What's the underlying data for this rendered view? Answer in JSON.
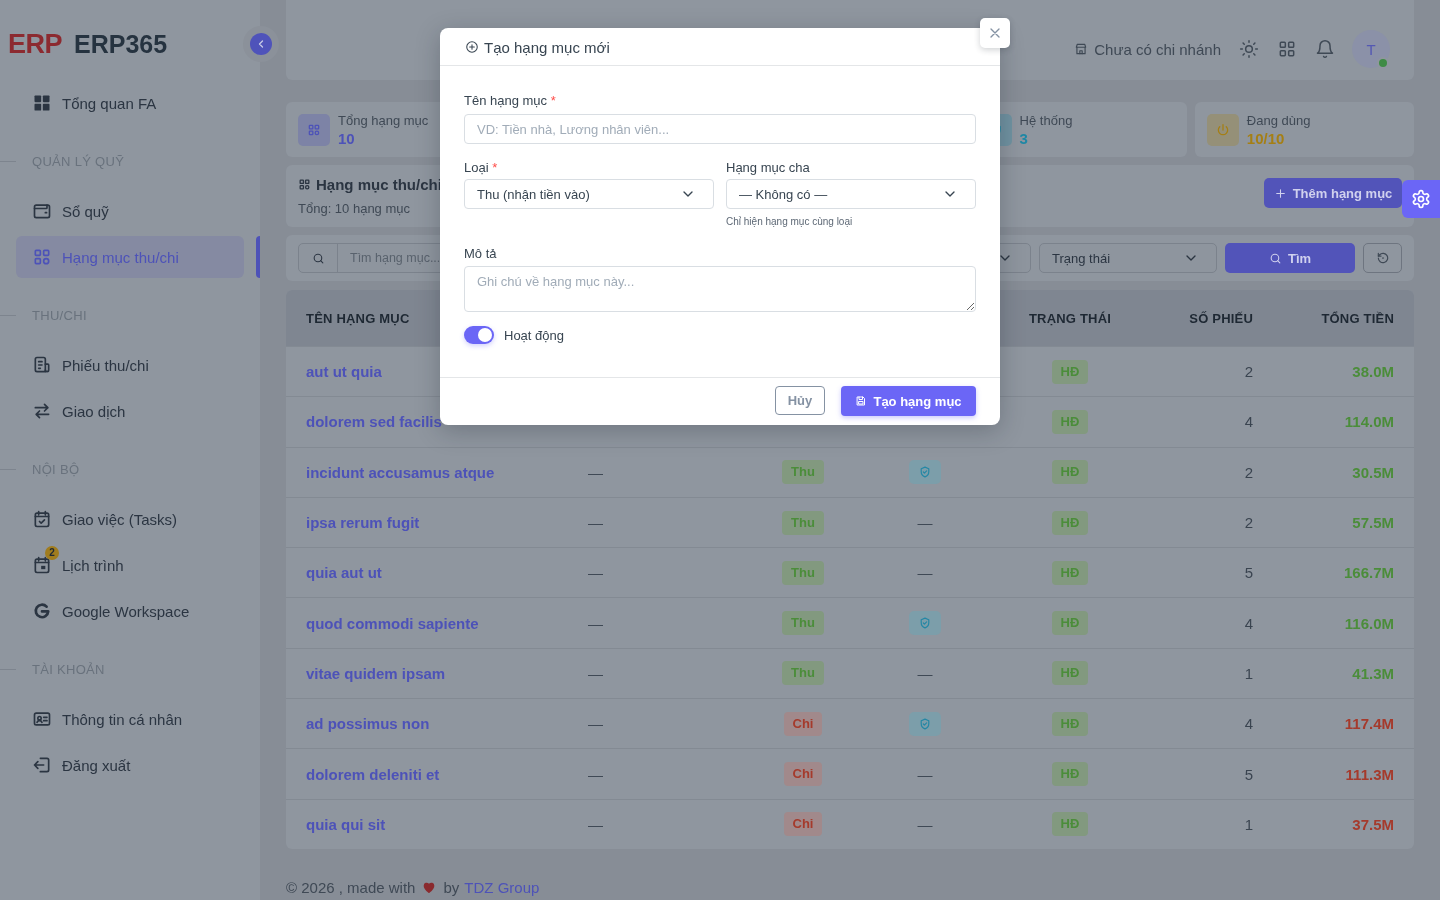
{
  "sidebar": {
    "logo_mark": "ERP",
    "brand": "ERP365",
    "groups": [
      {
        "items": [
          {
            "label": "Tổng quan FA",
            "selected": false
          }
        ]
      },
      {
        "heading": "QUẢN LÝ QUỸ",
        "items": [
          {
            "label": "Sổ quỹ",
            "selected": false
          },
          {
            "label": "Hạng mục thu/chi",
            "selected": true
          }
        ]
      },
      {
        "heading": "THU/CHI",
        "items": [
          {
            "label": "Phiếu thu/chi",
            "selected": false
          },
          {
            "label": "Giao dịch",
            "selected": false
          }
        ]
      },
      {
        "heading": "NỘI BỘ",
        "items": [
          {
            "label": "Giao việc (Tasks)",
            "selected": false
          },
          {
            "label": "Lịch trình",
            "selected": false,
            "badge": "2"
          },
          {
            "label": "Google Workspace",
            "selected": false
          }
        ]
      },
      {
        "heading": "TÀI KHOẢN",
        "items": [
          {
            "label": "Thông tin cá nhân",
            "selected": false
          },
          {
            "label": "Đăng xuất",
            "selected": false
          }
        ]
      }
    ]
  },
  "navbar": {
    "branch": "Chưa có chi nhánh",
    "avatar_initial": "T",
    "online": true
  },
  "stats": [
    {
      "label": "Tổng hạng mục",
      "value": "10",
      "color": "#4d52b8"
    },
    {
      "label": "Hệ thống",
      "value": "3",
      "color": "#1f88a6"
    },
    {
      "label": "Đang dùng",
      "value": "10/10",
      "color": "#a57f14"
    }
  ],
  "page_header": {
    "title": "Hạng mục thu/chi",
    "subtitle": "Tổng: 10 hạng mục",
    "add_button": "Thêm hạng mục"
  },
  "filters": {
    "search": {
      "placeholder": "Tìm hạng mục..."
    },
    "status_select": {
      "placeholder": "Trạng thái"
    },
    "search_button": "Tìm"
  },
  "table": {
    "columns": [
      "TÊN HẠNG MỤC",
      "TRẠNG THÁI",
      "SỐ PHIẾU",
      "TỔNG TIỀN"
    ],
    "rows": [
      {
        "name": "aut ut quia",
        "kind": "thu",
        "status": "HĐ",
        "active": true,
        "count": "2",
        "total": "38.0M"
      },
      {
        "name": "dolorem sed facilis",
        "kind": "thu",
        "status": "HĐ",
        "active": true,
        "count": "4",
        "total": "114.0M"
      },
      {
        "name": "incidunt accusamus atque",
        "kind": "thu",
        "parent": "—",
        "type": "Thu",
        "system": true,
        "status": "HĐ",
        "active": true,
        "count": "2",
        "total": "30.5M"
      },
      {
        "name": "ipsa rerum fugit",
        "kind": "thu",
        "parent": "—",
        "type": "Thu",
        "system": false,
        "system_text": "—",
        "status": "HĐ",
        "active": true,
        "count": "2",
        "total": "57.5M"
      },
      {
        "name": "quia aut ut",
        "kind": "thu",
        "parent": "—",
        "type": "Thu",
        "system": false,
        "system_text": "—",
        "status": "HĐ",
        "active": true,
        "count": "5",
        "total": "166.7M"
      },
      {
        "name": "quod commodi sapiente",
        "kind": "thu",
        "parent": "—",
        "type": "Thu",
        "system": true,
        "status": "HĐ",
        "active": true,
        "count": "4",
        "total": "116.0M"
      },
      {
        "name": "vitae quidem ipsam",
        "kind": "thu",
        "parent": "—",
        "type": "Thu",
        "system": false,
        "system_text": "—",
        "status": "HĐ",
        "active": true,
        "count": "1",
        "total": "41.3M"
      },
      {
        "name": "ad possimus non",
        "kind": "chi",
        "parent": "—",
        "type": "Chi",
        "system": true,
        "status": "HĐ",
        "active": true,
        "count": "4",
        "total": "117.4M"
      },
      {
        "name": "dolorem deleniti et",
        "kind": "chi",
        "parent": "—",
        "type": "Chi",
        "system": false,
        "system_text": "—",
        "status": "HĐ",
        "active": true,
        "count": "5",
        "total": "111.3M"
      },
      {
        "name": "quia qui sit",
        "kind": "chi",
        "parent": "—",
        "type": "Chi",
        "system": false,
        "system_text": "—",
        "status": "HĐ",
        "active": true,
        "count": "1",
        "total": "37.5M"
      }
    ]
  },
  "modal": {
    "title": "Tạo hạng mục mới",
    "name_field": {
      "label": "Tên hạng mục",
      "required_mark": "*",
      "placeholder": "VD: Tiền nhà, Lương nhân viên..."
    },
    "type_field": {
      "label": "Loại",
      "required_mark": "*",
      "value": "Thu (nhận tiền vào)"
    },
    "parent_field": {
      "label": "Hạng mục cha",
      "value": "— Không có —",
      "hint": "Chỉ hiện hạng mục cùng loại"
    },
    "description_field": {
      "label": "Mô tả",
      "placeholder": "Ghi chú về hạng mục này..."
    },
    "active_toggle": {
      "label": "Hoạt động",
      "on": true
    },
    "cancel_button": "Hủy",
    "submit_button": "Tạo hạng mục"
  },
  "footer": {
    "text": "© 2026 , made with",
    "text_after": "by",
    "link": "TDZ Group"
  }
}
